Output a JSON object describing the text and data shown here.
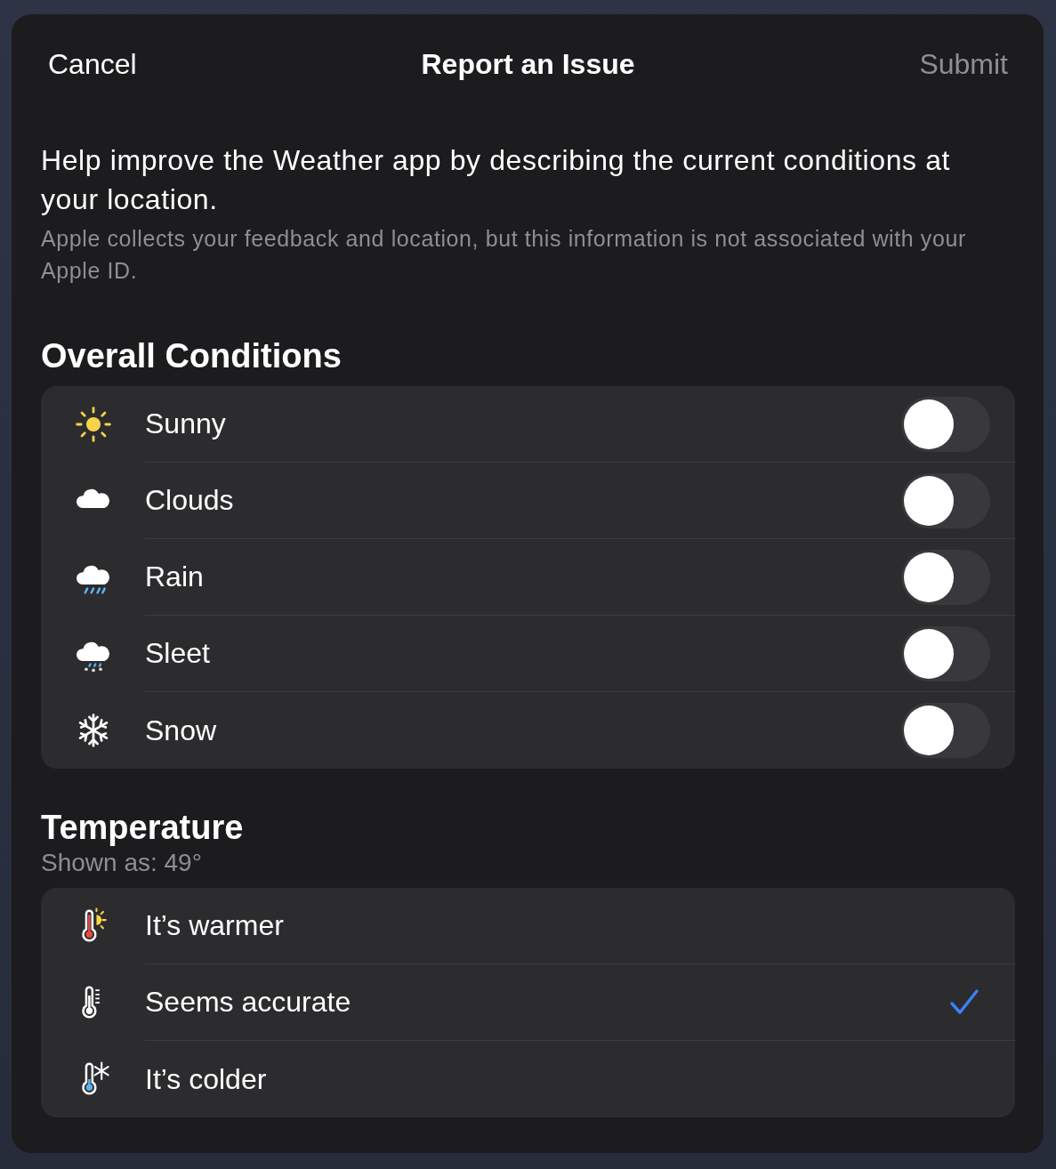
{
  "header": {
    "cancel": "Cancel",
    "title": "Report an Issue",
    "submit": {
      "label": "Submit",
      "disabled": true
    }
  },
  "intro": "Help improve the Weather app by describing the current conditions at your location.",
  "note": "Apple collects your feedback and location, but this information is not associated with your Apple ID.",
  "conditions": {
    "heading": "Overall Conditions",
    "items": [
      {
        "kind": "sunny",
        "label": "Sunny",
        "on": false
      },
      {
        "kind": "clouds",
        "label": "Clouds",
        "on": false
      },
      {
        "kind": "rain",
        "label": "Rain",
        "on": false
      },
      {
        "kind": "sleet",
        "label": "Sleet",
        "on": false
      },
      {
        "kind": "snow",
        "label": "Snow",
        "on": false
      }
    ]
  },
  "temperature": {
    "heading": "Temperature",
    "subtitle": "Shown as: 49°",
    "options": [
      {
        "kind": "warmer",
        "label": "It’s warmer",
        "selected": false
      },
      {
        "kind": "accurate",
        "label": "Seems accurate",
        "selected": true
      },
      {
        "kind": "colder",
        "label": "It’s colder",
        "selected": false
      }
    ]
  }
}
